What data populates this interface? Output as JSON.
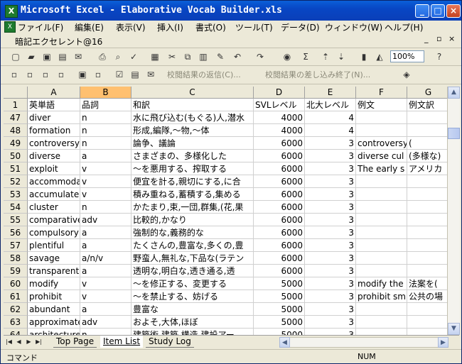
{
  "window": {
    "title": "Microsoft Excel - Elaborative Vocab Builder.xls",
    "controls": [
      "_",
      "□",
      "×"
    ]
  },
  "menu": {
    "items": [
      "ファイル(F)",
      "編集(E)",
      "表示(V)",
      "挿入(I)",
      "書式(O)",
      "ツール(T)",
      "データ(D)",
      "ウィンドウ(W)",
      "ヘルプ(H)"
    ],
    "doc_controls": [
      "_",
      "▫",
      "×"
    ]
  },
  "name_box": "暗記エクセレント@16",
  "toolbar": {
    "zoom": "100%",
    "review_reply": "校閲結果の返信(C)...",
    "review_end": "校閲結果の差し込み終了(N)..."
  },
  "grid": {
    "columns": [
      "A",
      "B",
      "C",
      "D",
      "E",
      "F",
      "G"
    ],
    "selected_column": "B",
    "header_row": {
      "num": "1",
      "cells": [
        "英単語",
        "品詞",
        "和訳",
        "SVLレベル",
        "北大レベル",
        "例文",
        "例文訳"
      ]
    },
    "rows": [
      {
        "num": "47",
        "cells": [
          "diver",
          "n",
          "水に飛び込む(もぐる)人,潜水",
          "4000",
          "4",
          "",
          ""
        ]
      },
      {
        "num": "48",
        "cells": [
          "formation",
          "n",
          "形成,編隊,〜物,〜体",
          "4000",
          "4",
          "",
          ""
        ]
      },
      {
        "num": "49",
        "cells": [
          "controversy",
          "n",
          "論争、議論",
          "6000",
          "3",
          "controversy",
          "("
        ]
      },
      {
        "num": "50",
        "cells": [
          "diverse",
          "a",
          "さまざまの、多様化した",
          "6000",
          "3",
          "diverse cul",
          "(多様な)"
        ]
      },
      {
        "num": "51",
        "cells": [
          "exploit",
          "v",
          "〜を悪用する、搾取する",
          "6000",
          "3",
          "The early s",
          "アメリカ"
        ]
      },
      {
        "num": "52",
        "cells": [
          "accommodate",
          "v",
          "便宜を計る,親切にする,に合",
          "6000",
          "3",
          "",
          ""
        ]
      },
      {
        "num": "53",
        "cells": [
          "accumulate",
          "v",
          "積み重ねる,蓄積する,集める",
          "6000",
          "3",
          "",
          ""
        ]
      },
      {
        "num": "54",
        "cells": [
          "cluster",
          "n",
          "かたまり,束,一団,群集,(花,果",
          "6000",
          "3",
          "",
          ""
        ]
      },
      {
        "num": "55",
        "cells": [
          "comparative",
          "adv",
          "比較的,かなり",
          "6000",
          "3",
          "",
          ""
        ]
      },
      {
        "num": "56",
        "cells": [
          "compulsory",
          "a",
          "強制的な,義務的な",
          "6000",
          "3",
          "",
          ""
        ]
      },
      {
        "num": "57",
        "cells": [
          "plentiful",
          "a",
          "たくさんの,豊富な,多くの,豊",
          "6000",
          "3",
          "",
          ""
        ]
      },
      {
        "num": "58",
        "cells": [
          "savage",
          "a/n/v",
          "野蛮人,無礼な,下品な(ラテン",
          "6000",
          "3",
          "",
          ""
        ]
      },
      {
        "num": "59",
        "cells": [
          "transparent",
          "a",
          "透明な,明白な,透き通る,透",
          "6000",
          "3",
          "",
          ""
        ]
      },
      {
        "num": "60",
        "cells": [
          "modify",
          "v",
          "〜を修正する、変更する",
          "5000",
          "3",
          "modify the",
          "法案を("
        ]
      },
      {
        "num": "61",
        "cells": [
          "prohibit",
          "v",
          "〜を禁止する、妨げる",
          "5000",
          "3",
          "prohibit sm",
          "公共の場"
        ]
      },
      {
        "num": "62",
        "cells": [
          "abundant",
          "a",
          "豊富な",
          "5000",
          "3",
          "",
          ""
        ]
      },
      {
        "num": "63",
        "cells": [
          "approximate",
          "adv",
          "およそ,大体,ほぼ",
          "5000",
          "3",
          "",
          ""
        ]
      },
      {
        "num": "64",
        "cells": [
          "architecture",
          "n",
          "建築術,建築,構造,建設アー",
          "5000",
          "3",
          "",
          ""
        ]
      }
    ]
  },
  "sheets": {
    "tabs": [
      "Top Page",
      "Item List",
      "Study Log"
    ],
    "active": "Item List"
  },
  "status": {
    "mode": "コマンド",
    "num": "NUM"
  }
}
